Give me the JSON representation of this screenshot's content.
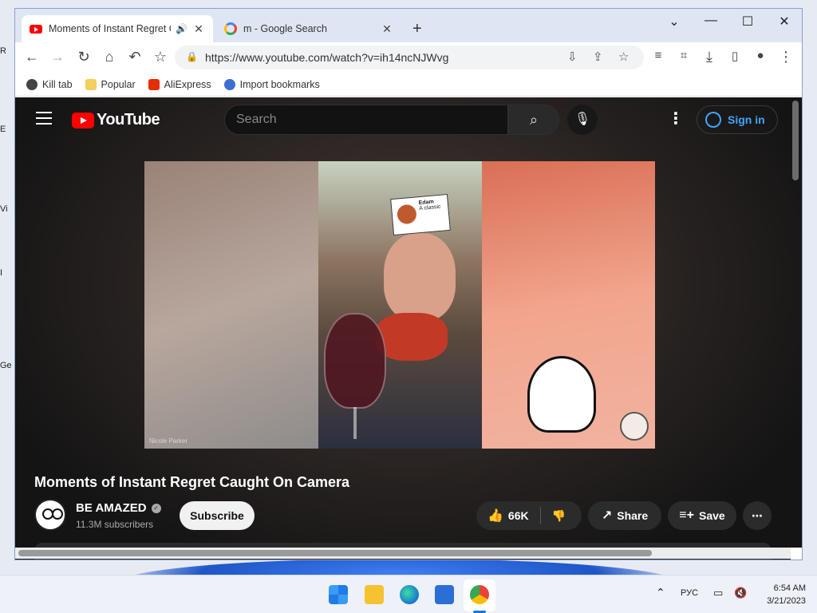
{
  "browser": {
    "tabs": [
      {
        "title": "Moments of Instant Regret C",
        "audio": "🔊",
        "active": true
      },
      {
        "title": "m - Google Search",
        "active": false
      }
    ],
    "url": "https://www.youtube.com/watch?v=ih14ncNJWvg",
    "bookmarks": [
      {
        "label": "Kill tab"
      },
      {
        "label": "Popular"
      },
      {
        "label": "AliExpress"
      },
      {
        "label": "Import bookmarks"
      }
    ]
  },
  "youtube": {
    "logo_text": "YouTube",
    "search_placeholder": "Search",
    "sign_in": "Sign in",
    "video_title": "Moments of Instant Regret Caught On Camera",
    "channel_name": "BE AMAZED",
    "subscribers": "11.3M subscribers",
    "subscribe_label": "Subscribe",
    "likes": "66K",
    "share_label": "Share",
    "save_label": "Save",
    "video_card_name": "Edam",
    "video_card_sub": "A classic",
    "video_watermark": "Nicole Parker"
  },
  "taskbar": {
    "language": "РУС",
    "time": "6:54 AM",
    "date": "3/21/2023"
  },
  "desktop_edge_labels": [
    "R",
    "E",
    "Vi",
    "I",
    "Ge"
  ]
}
